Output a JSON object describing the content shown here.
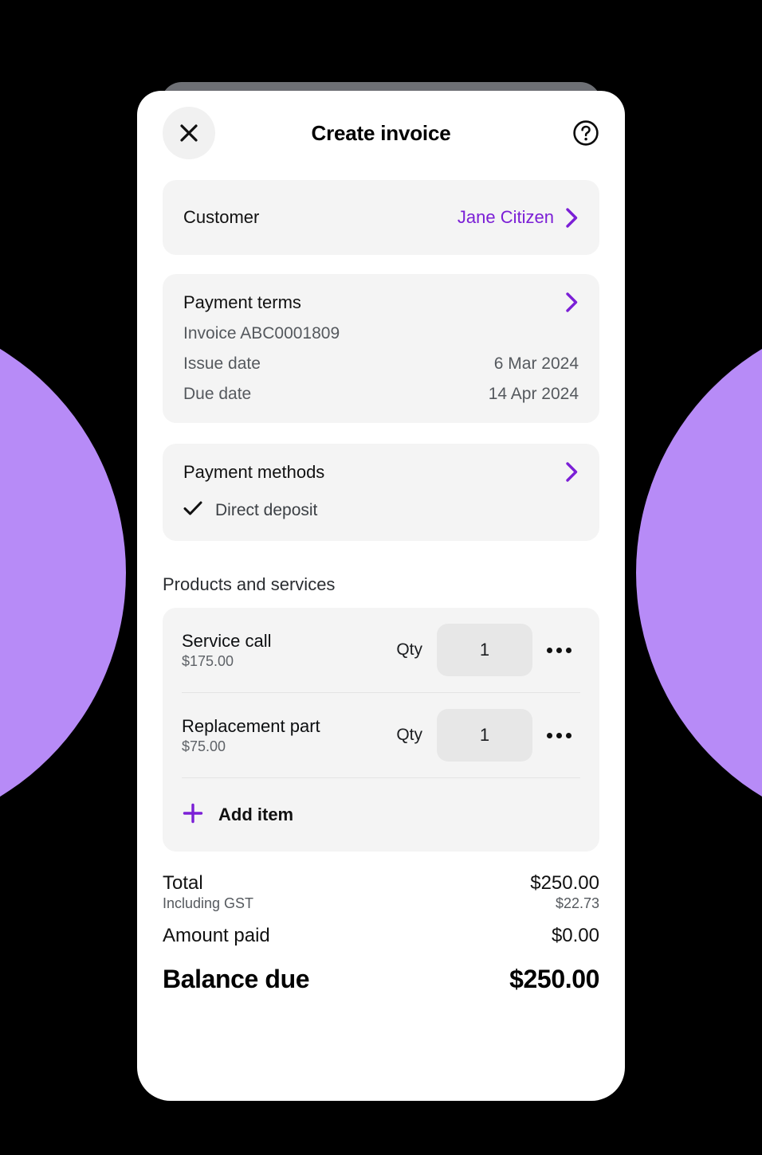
{
  "theme": {
    "accent_purple": "#7B1FD6",
    "blob_purple": "#B78BF7",
    "card_grey": "#F4F4F4",
    "page_background": "#000000"
  },
  "header": {
    "title": "Create invoice",
    "close_icon": "close-icon",
    "help_icon": "help-circle-icon"
  },
  "customer": {
    "label": "Customer",
    "value": "Jane Citizen",
    "chevron_icon": "chevron-right-icon"
  },
  "payment_terms": {
    "title": "Payment terms",
    "chevron_icon": "chevron-right-icon",
    "invoice_number_line": "Invoice ABC0001809",
    "rows": [
      {
        "label": "Issue date",
        "value": "6 Mar 2024"
      },
      {
        "label": "Due date",
        "value": "14 Apr 2024"
      }
    ]
  },
  "payment_methods": {
    "title": "Payment methods",
    "chevron_icon": "chevron-right-icon",
    "methods": [
      {
        "name": "Direct deposit",
        "check_icon": "check-icon",
        "selected": true
      }
    ]
  },
  "products": {
    "heading": "Products and services",
    "qty_label": "Qty",
    "more_icon": "ellipsis-icon",
    "items": [
      {
        "name": "Service call",
        "price": "$175.00",
        "qty": "1"
      },
      {
        "name": "Replacement part",
        "price": "$75.00",
        "qty": "1"
      }
    ],
    "add_item": {
      "label": "Add item",
      "plus_icon": "plus-icon"
    }
  },
  "totals": {
    "total_label": "Total",
    "total_value": "$250.00",
    "tax_label": "Including GST",
    "tax_value": "$22.73",
    "paid_label": "Amount paid",
    "paid_value": "$0.00",
    "balance_label": "Balance due",
    "balance_value": "$250.00"
  }
}
